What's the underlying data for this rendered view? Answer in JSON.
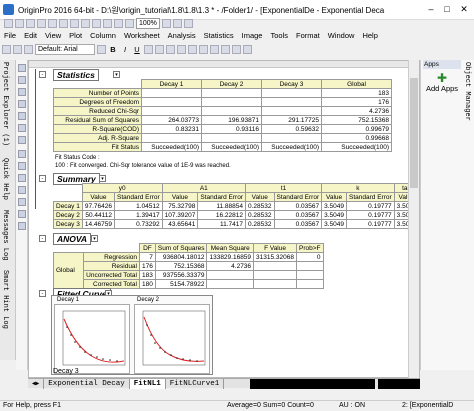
{
  "window": {
    "title": "OriginPro 2016 64-bit - D:\\원\\origin_tutorial\\1.8\\1.8\\1.3 * - /Folder1/ - [ExponentialDe - Exponential Deca",
    "zoom": "100%"
  },
  "menu": [
    "File",
    "Edit",
    "View",
    "Plot",
    "Column",
    "Worksheet",
    "Analysis",
    "Statistics",
    "Image",
    "Tools",
    "Format",
    "Window",
    "Help"
  ],
  "toolbar": {
    "font": "Default: Arial",
    "bold": "B",
    "italic": "I",
    "underline": "U"
  },
  "left_dock_tabs": [
    "Project Explorer (1)",
    "Quick Help",
    "Messages Log",
    "Smart Hint Log"
  ],
  "right_dock": {
    "apps_header": "Apps",
    "add_apps": "Add Apps",
    "object_manager": "Object Manager"
  },
  "statistics": {
    "title": "Statistics",
    "headers": [
      "Decay 1",
      "Decay 2",
      "Decay 3",
      "Global"
    ],
    "rows": [
      {
        "label": "Number of Points",
        "vals": [
          "",
          "",
          "",
          "183"
        ]
      },
      {
        "label": "Degrees of Freedom",
        "vals": [
          "",
          "",
          "",
          "176"
        ]
      },
      {
        "label": "Reduced Chi-Sqr",
        "vals": [
          "",
          "",
          "",
          "4.2736"
        ]
      },
      {
        "label": "Residual Sum of Squares",
        "vals": [
          "264.03773",
          "196.93871",
          "291.17725",
          "752.15368"
        ]
      },
      {
        "label": "R-Square(COD)",
        "vals": [
          "0.83231",
          "0.93116",
          "0.59632",
          "0.99679"
        ]
      },
      {
        "label": "Adj. R-Square",
        "vals": [
          "",
          "",
          "",
          "0.99668"
        ]
      },
      {
        "label": "Fit Status",
        "vals": [
          "Succeeded(100)",
          "Succeeded(100)",
          "Succeeded(100)",
          "Succeeded(100)"
        ]
      }
    ],
    "note1": "Fit Status Code :",
    "note2": "100 : Fit converged. Chi-Sqr tolerance value of 1E-9 was reached."
  },
  "summary": {
    "title": "Summary",
    "groups": [
      "y0",
      "A1",
      "t1",
      "k",
      "tau"
    ],
    "subheaders": [
      "Value",
      "Standard Error",
      "Value",
      "Standard Error",
      "Value",
      "Standard Error",
      "Value",
      "Standard Error",
      "Value"
    ],
    "rows": [
      {
        "label": "Decay 1",
        "vals": [
          "97.76426",
          "1.04512",
          "75.32798",
          "11.88854",
          "0.28532",
          "0.03567",
          "3.5049",
          "0.19777",
          "3.5049"
        ]
      },
      {
        "label": "Decay 2",
        "vals": [
          "50.44112",
          "1.39417",
          "107.39207",
          "16.22812",
          "0.28532",
          "0.03567",
          "3.5049",
          "0.19777",
          "3.5049"
        ]
      },
      {
        "label": "Decay 3",
        "vals": [
          "14.46759",
          "0.73292",
          "43.65641",
          "11.7417",
          "0.28532",
          "0.03567",
          "3.5049",
          "0.19777",
          "3.5049"
        ]
      }
    ]
  },
  "anova": {
    "title": "ANOVA",
    "headers": [
      "DF",
      "Sum of Squares",
      "Mean Square",
      "F Value",
      "Prob>F"
    ],
    "group_label": "Global",
    "rows": [
      {
        "label": "Regression",
        "vals": [
          "7",
          "936804.18012",
          "133829.16859",
          "31315.32068",
          "0"
        ]
      },
      {
        "label": "Residual",
        "vals": [
          "176",
          "752.15368",
          "4.2736",
          "",
          ""
        ]
      },
      {
        "label": "Uncorrected Total",
        "vals": [
          "183",
          "937556.33379",
          "",
          "",
          ""
        ]
      },
      {
        "label": "Corrected Total",
        "vals": [
          "180",
          "5154.78922",
          "",
          "",
          ""
        ]
      }
    ]
  },
  "fitted_curve": {
    "title": "Fitted Curve",
    "graph1": "Decay 1",
    "graph2": "Decay 2",
    "graph3": "Decay 3"
  },
  "sheet_tabs": [
    "Exponential Decay",
    "FitNL1",
    "FitNLCurve1"
  ],
  "status": {
    "help": "For Help, press F1",
    "average": "Average=0 Sum=0 Count=0",
    "au": "AU : ON",
    "book": "2: [ExponentialD"
  }
}
